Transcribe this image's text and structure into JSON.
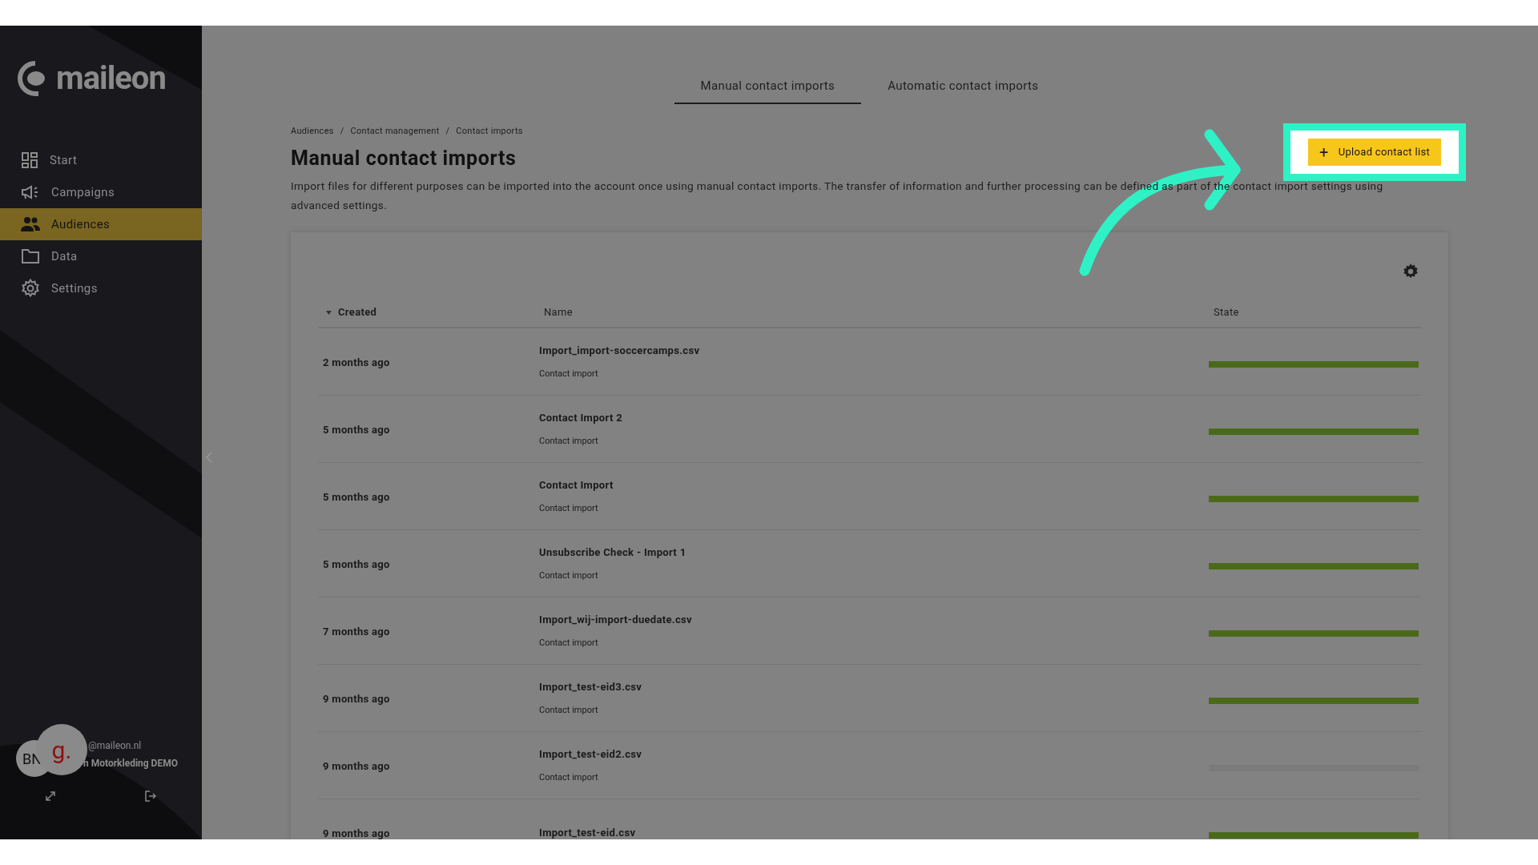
{
  "sidebar": {
    "logo": "maileon",
    "items": [
      {
        "label": "Start",
        "selected": false
      },
      {
        "label": "Campaigns",
        "selected": false
      },
      {
        "label": "Audiences",
        "selected": true
      },
      {
        "label": "Data",
        "selected": false
      },
      {
        "label": "Settings",
        "selected": false
      }
    ],
    "user": {
      "initials": "BN",
      "email": "@maileon.nl",
      "account": "n Motorkleding DEMO",
      "brand_mark": "g."
    }
  },
  "tabs": [
    {
      "label": "Manual contact imports",
      "selected": true
    },
    {
      "label": "Automatic contact imports",
      "selected": false
    }
  ],
  "breadcrumb": {
    "separator": "/",
    "items": [
      "Audiences",
      "Contact management",
      "Contact imports"
    ]
  },
  "title": "Manual contact imports",
  "description": "Import files for different purposes can be imported into the account once using manual contact imports. The transfer of information and further processing can be defined as part of the contact import settings using advanced settings.",
  "upload_button": {
    "icon": "+",
    "label": "Upload contact list"
  },
  "table": {
    "columns": [
      "Created",
      "Name",
      "State"
    ],
    "rows": [
      {
        "created": "2 months ago",
        "name": "Import_import-soccercamps.csv",
        "type": "Contact import",
        "level": 1
      },
      {
        "created": "5 months ago",
        "name": "Contact Import 2",
        "type": "Contact import",
        "level": 1
      },
      {
        "created": "5 months ago",
        "name": "Contact Import",
        "type": "Contact import",
        "level": 1
      },
      {
        "created": "5 months ago",
        "name": "Unsubscribe Check - Import 1",
        "type": "Contact import",
        "level": 1
      },
      {
        "created": "7 months ago",
        "name": "Import_wij-import-duedate.csv",
        "type": "Contact import",
        "level": 1
      },
      {
        "created": "9 months ago",
        "name": "Import_test-eid3.csv",
        "type": "Contact import",
        "level": 1
      },
      {
        "created": "9 months ago",
        "name": "Import_test-eid2.csv",
        "type": "Contact import",
        "level": 0
      },
      {
        "created": "9 months ago",
        "name": "Import_test-eid.csv",
        "level": 1
      }
    ]
  }
}
